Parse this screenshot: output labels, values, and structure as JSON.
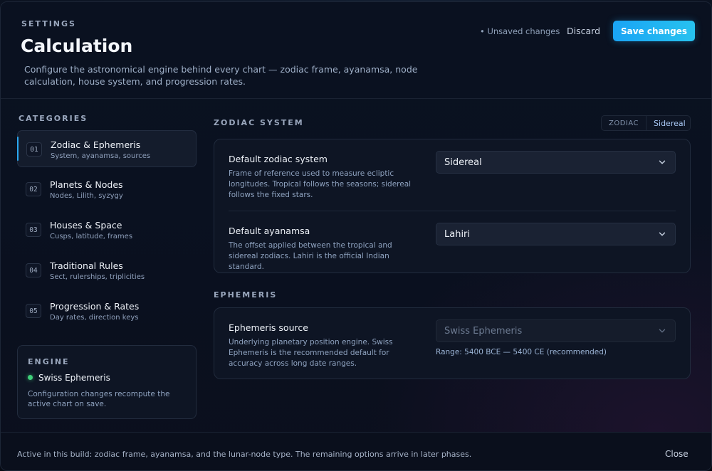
{
  "header": {
    "eyebrow": "SETTINGS",
    "title": "Calculation",
    "subtitle": "Configure the astronomical engine behind every chart — zodiac frame, ayanamsa, node calculation, house system, and progression rates.",
    "unsaved_label": "• Unsaved changes",
    "discard_label": "Discard",
    "save_label": "Save changes"
  },
  "sidebar": {
    "heading": "CATEGORIES",
    "items": [
      {
        "num": "01",
        "title": "Zodiac & Ephemeris",
        "sub": "System, ayanamsa, sources",
        "active": true
      },
      {
        "num": "02",
        "title": "Planets & Nodes",
        "sub": "Nodes, Lilith, syzygy"
      },
      {
        "num": "03",
        "title": "Houses & Space",
        "sub": "Cusps, latitude, frames"
      },
      {
        "num": "04",
        "title": "Traditional Rules",
        "sub": "Sect, rulerships, triplicities"
      },
      {
        "num": "05",
        "title": "Progression & Rates",
        "sub": "Day rates, direction keys"
      }
    ],
    "engine": {
      "heading": "ENGINE",
      "name": "Swiss Ephemeris",
      "status_color": "#3fd07a",
      "note": "Configuration changes recompute the active chart on save."
    }
  },
  "zodiac_section": {
    "heading": "ZODIAC SYSTEM",
    "toggle": {
      "label": "ZODIAC",
      "value": "Sidereal"
    },
    "settings": [
      {
        "title": "Default zodiac system",
        "description": "Frame of reference used to measure ecliptic longitudes. Tropical follows the seasons; sidereal follows the fixed stars.",
        "value": "Sidereal"
      },
      {
        "title": "Default ayanamsa",
        "description": "The offset applied between the tropical and sidereal zodiacs. Lahiri is the official Indian standard.",
        "value": "Lahiri"
      }
    ]
  },
  "ephemeris_section": {
    "heading": "EPHEMERIS",
    "setting": {
      "title": "Ephemeris source",
      "description": "Underlying planetary position engine. Swiss Ephemeris is the recommended default for accuracy across long date ranges.",
      "value": "Swiss Ephemeris",
      "range_note": "Range: 5400 BCE — 5400 CE (recommended)"
    }
  },
  "footer": {
    "note": "Active in this build: zodiac frame, ayanamsa, and the lunar-node type. The remaining options arrive in later phases.",
    "close_label": "Close"
  },
  "colors": {
    "accent": "#27b4f2",
    "background": "#0a1120",
    "status_active": "#3fd07a"
  }
}
